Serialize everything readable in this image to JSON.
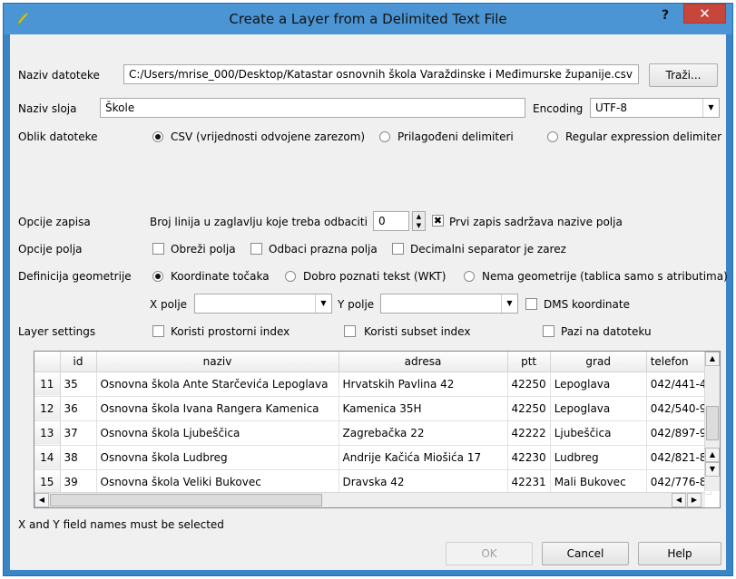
{
  "window": {
    "title": "Create a Layer from a Delimited Text File",
    "help_glyph": "?",
    "close_glyph": "✕"
  },
  "file": {
    "label": "Naziv datoteke",
    "value": "C:/Users/mrise_000/Desktop/Katastar osnovnih škola Varaždinske i Međimurske županije.csv",
    "browse_label": "Traži..."
  },
  "layer": {
    "label": "Naziv sloja",
    "value": "Škole",
    "encoding_label": "Encoding",
    "encoding_value": "UTF-8"
  },
  "file_format": {
    "label": "Oblik datoteke",
    "options": [
      "CSV (vrijednosti odvojene zarezom)",
      "Prilagođeni delimiteri",
      "Regular expression delimiter"
    ],
    "selected": 0
  },
  "record_options": {
    "label": "Opcije zapisa",
    "skip_lines_label": "Broj linija u zaglavlju koje treba odbaciti",
    "skip_lines_value": "0",
    "first_record_label": "Prvi zapis sadržava nazive polja",
    "first_record_checked": true
  },
  "field_options": {
    "label": "Opcije polja",
    "trim_label": "Obreži polja",
    "discard_empty_label": "Odbaci prazna polja",
    "decimal_comma_label": "Decimalni separator je zarez"
  },
  "geometry": {
    "label": "Definicija geometrije",
    "options": [
      "Koordinate točaka",
      "Dobro poznati tekst (WKT)",
      "Nema geometrije (tablica samo s atributima)"
    ],
    "selected": 0,
    "x_label": "X polje",
    "y_label": "Y polje",
    "x_value": "",
    "y_value": "",
    "dms_label": "DMS koordinate"
  },
  "layer_settings": {
    "label": "Layer settings",
    "spatial_index_label": "Koristi prostorni index",
    "subset_index_label": "Koristi subset index",
    "watch_file_label": "Pazi na datoteku"
  },
  "table": {
    "columns": [
      "id",
      "naziv",
      "adresa",
      "ptt",
      "grad",
      "telefon"
    ],
    "rows": [
      {
        "num": "11",
        "cells": [
          "35",
          "Osnovna škola Ante Starčevića Lepoglava",
          "Hrvatskih Pavlina 42",
          "42250",
          "Lepoglava",
          "042/441-4"
        ]
      },
      {
        "num": "12",
        "cells": [
          "36",
          "Osnovna škola Ivana Rangera Kamenica",
          "Kamenica 35H",
          "42250",
          "Lepoglava",
          "042/540-9"
        ]
      },
      {
        "num": "13",
        "cells": [
          "37",
          "Osnovna škola Ljubeščica",
          "Zagrebačka 22",
          "42222",
          "Ljubeščica",
          "042/897-9"
        ]
      },
      {
        "num": "14",
        "cells": [
          "38",
          "Osnovna škola Ludbreg",
          "Andrije Kačića Miošića 17",
          "42230",
          "Ludbreg",
          "042/821-8"
        ]
      },
      {
        "num": "15",
        "cells": [
          "39",
          "Osnovna škola Veliki Bukovec",
          "Dravska 42",
          "42231",
          "Mali Bukovec",
          "042/776-8"
        ]
      }
    ]
  },
  "status": "X and Y field names must be selected",
  "buttons": {
    "ok": "OK",
    "cancel": "Cancel",
    "help": "Help"
  },
  "icons": {
    "app": "qgis-icon",
    "dropdown": "chevron-down-icon"
  }
}
